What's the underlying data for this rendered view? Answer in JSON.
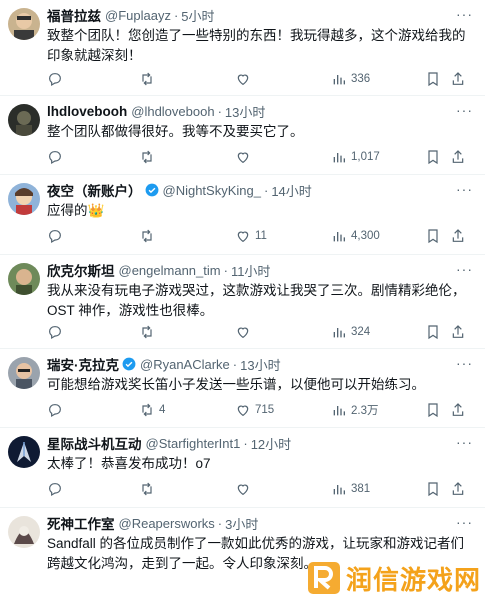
{
  "tweets": [
    {
      "name": "福普拉兹",
      "handle": "@Fuplaayz",
      "time": "5小时",
      "text": "致整个团队！您创造了一些特别的东西！我玩得越多，这个游戏给我的印象就越深刻！",
      "replies": "",
      "retweets": "",
      "likes": "",
      "views": "336"
    },
    {
      "name": "lhdlovebooh",
      "handle": "@lhdlovebooh",
      "time": "13小时",
      "text": "整个团队都做得很好。我等不及要买它了。",
      "replies": "",
      "retweets": "",
      "likes": "",
      "views": "1,017"
    },
    {
      "name": "夜空（新账户）",
      "handle": "@NightSkyKing_",
      "time": "14小时",
      "text": "应得的👑",
      "replies": "",
      "retweets": "",
      "likes": "11",
      "views": "4,300"
    },
    {
      "name": "欣克尔斯坦",
      "handle": "@engelmann_tim",
      "time": "11小时",
      "text": "我从来没有玩电子游戏哭过，这款游戏让我哭了三次。剧情精彩绝伦，OST 神作，游戏性也很棒。",
      "replies": "",
      "retweets": "",
      "likes": "",
      "views": "324"
    },
    {
      "name": "瑞安·克拉克",
      "handle": "@RyanAClarke",
      "time": "13小时",
      "text": "可能想给游戏奖长笛小子发送一些乐谱，以便他可以开始练习。",
      "replies": "",
      "retweets": "4",
      "likes": "715",
      "views": "2.3万"
    },
    {
      "name": "星际战斗机互动",
      "handle": "@StarfighterInt1",
      "time": "12小时",
      "text": "太棒了！恭喜发布成功！o7",
      "replies": "",
      "retweets": "",
      "likes": "",
      "views": "381"
    },
    {
      "name": "死神工作室",
      "handle": "@Reapersworks",
      "time": "3小时",
      "text": "Sandfall 的各位成员制作了一款如此优秀的游戏，让玩家和游戏记者们跨越文化鸿沟，走到了一起。令人印象深刻。",
      "replies": "",
      "retweets": "",
      "likes": "",
      "views": ""
    }
  ],
  "watermark": {
    "text": "润信游戏网"
  },
  "colors": {
    "verified": "#1d9bf0",
    "muted": "#536471",
    "watermark": "#f4a21b"
  }
}
